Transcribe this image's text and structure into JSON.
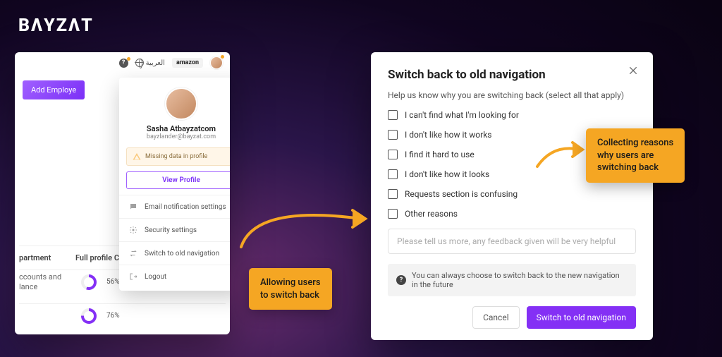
{
  "brand": "BΛYZΛT",
  "topbar": {
    "arabic": "العربية",
    "amazon": "amazon"
  },
  "addEmployee": "Add Employe",
  "table": {
    "headers": {
      "dept": "partment",
      "profile": "Full profile C"
    },
    "rows": [
      {
        "dept": "ccounts and\nlance",
        "pct": "56%"
      },
      {
        "dept": "",
        "pct": "76%"
      }
    ]
  },
  "dropdown": {
    "name": "Sasha Atbayzatcom",
    "email": "bayzlander@bayzat.com",
    "warn": "Missing data in profile",
    "viewProfile": "View Profile",
    "items": [
      "Email notification settings",
      "Security settings",
      "Switch to old navigation",
      "Logout"
    ]
  },
  "modal": {
    "title": "Switch back to old navigation",
    "subtitle": "Help us know why you are switching back (select all that apply)",
    "options": [
      "I can't find what I'm looking for",
      "I don't like how it works",
      "I find it hard to use",
      "I don't like how it looks",
      "Requests section is confusing",
      "Other reasons"
    ],
    "placeholder": "Please tell us more, any feedback given will be very helpful",
    "info": "You can always choose to switch back to the new navigation in the future",
    "cancel": "Cancel",
    "confirm": "Switch to old navigation"
  },
  "callouts": {
    "left": "Allowing users\nto switch back",
    "right": "Collecting reasons\nwhy users are\nswitching back"
  }
}
